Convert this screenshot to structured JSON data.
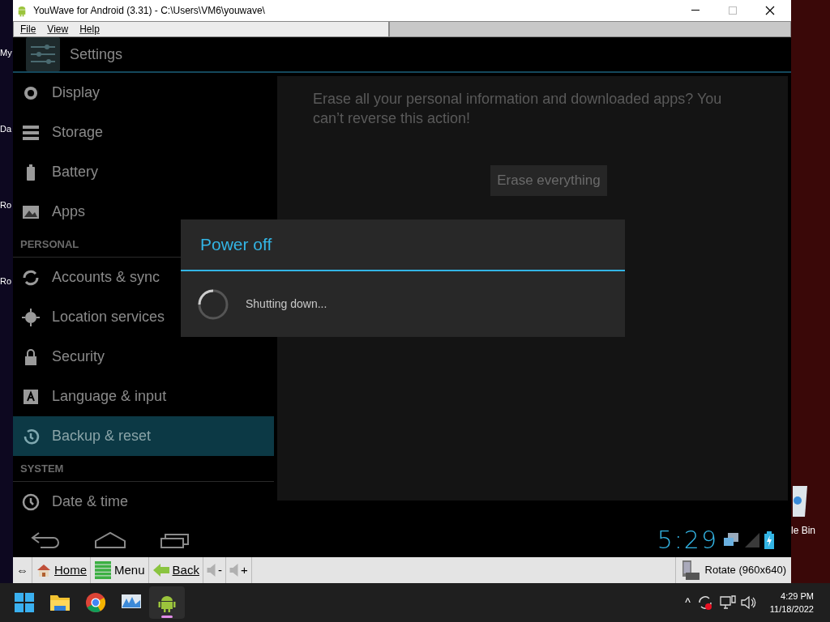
{
  "desktop": {
    "left_labels": [
      "My",
      "Da",
      "Ro",
      "Ro"
    ],
    "right_label": "le Bin"
  },
  "window": {
    "title": "YouWave for Android (3.31) - C:\\Users\\VM6\\youwave\\"
  },
  "menu": [
    {
      "label": "File"
    },
    {
      "label": "View"
    },
    {
      "label": "Help"
    }
  ],
  "action_bar": {
    "title": "Settings"
  },
  "sidebar": [
    {
      "kind": "item",
      "label": "Display",
      "selected": false
    },
    {
      "kind": "item",
      "label": "Storage",
      "selected": false
    },
    {
      "kind": "item",
      "label": "Battery",
      "selected": false
    },
    {
      "kind": "item",
      "label": "Apps",
      "selected": false
    },
    {
      "kind": "header",
      "label": "PERSONAL"
    },
    {
      "kind": "item",
      "label": "Accounts & sync",
      "selected": false
    },
    {
      "kind": "item",
      "label": "Location services",
      "selected": false
    },
    {
      "kind": "item",
      "label": "Security",
      "selected": false
    },
    {
      "kind": "item",
      "label": "Language & input",
      "selected": false
    },
    {
      "kind": "item",
      "label": "Backup & reset",
      "selected": true
    },
    {
      "kind": "header",
      "label": "SYSTEM"
    },
    {
      "kind": "item",
      "label": "Date & time",
      "selected": false
    }
  ],
  "pane": {
    "message": "Erase all your personal information and downloaded apps? You can’t reverse this action!",
    "button": "Erase everything"
  },
  "dialog": {
    "title": "Power off",
    "message": "Shutting down..."
  },
  "status": {
    "clock": "5:29"
  },
  "toolbar": [
    {
      "kind": "arrows",
      "label": "⇔"
    },
    {
      "kind": "home",
      "label": "Home"
    },
    {
      "kind": "menu",
      "label": "Menu"
    },
    {
      "kind": "back",
      "label": "Back"
    },
    {
      "kind": "voldown",
      "label": "-"
    },
    {
      "kind": "volup",
      "label": "+"
    }
  ],
  "rotate": {
    "label": "Rotate (960x640)"
  },
  "taskbar": [
    {
      "kind": "start",
      "selected": false
    },
    {
      "kind": "folder",
      "selected": false
    },
    {
      "kind": "browser",
      "selected": false
    },
    {
      "kind": "monitor",
      "selected": false
    },
    {
      "kind": "android",
      "selected": true
    }
  ],
  "tray": {
    "chevron": "^",
    "time": "4:29 PM",
    "date": "11/18/2022"
  }
}
